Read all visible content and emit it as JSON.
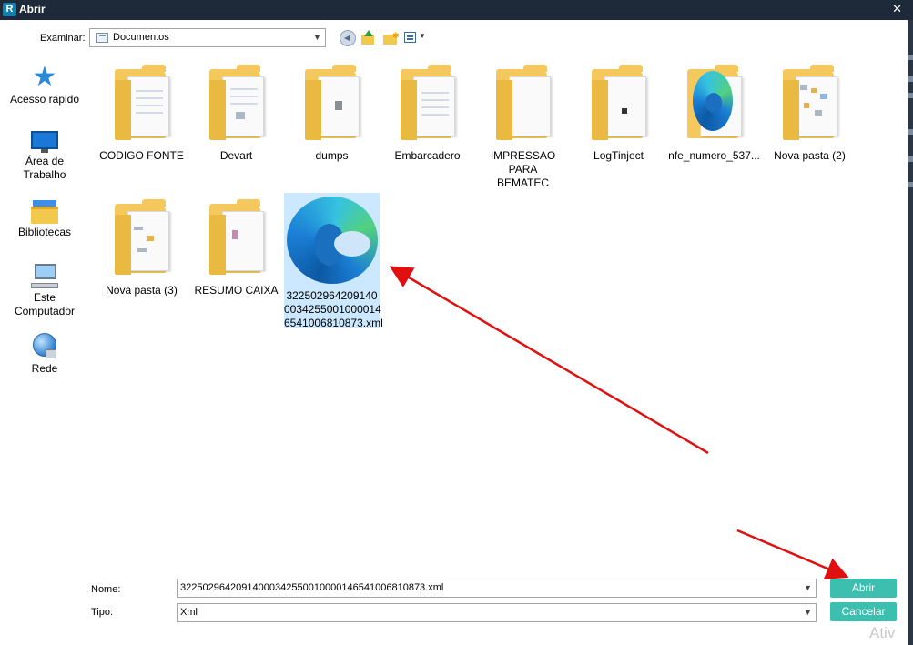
{
  "window": {
    "title": "Abrir",
    "app_icon_letter": "R"
  },
  "toolbar": {
    "lookin_label": "Examinar:",
    "lookin_value": "Documentos"
  },
  "places": [
    {
      "label": "Acesso rápido",
      "icon": "star-icon"
    },
    {
      "label_line1": "Área de",
      "label_line2": "Trabalho",
      "icon": "desktop-icon"
    },
    {
      "label": "Bibliotecas",
      "icon": "libraries-icon"
    },
    {
      "label_line1": "Este",
      "label_line2": "Computador",
      "icon": "computer-icon"
    },
    {
      "label": "Rede",
      "icon": "network-icon"
    }
  ],
  "files": [
    {
      "name": "CODIGO FONTE",
      "type": "folder"
    },
    {
      "name": "Devart",
      "type": "folder"
    },
    {
      "name": "dumps",
      "type": "folder"
    },
    {
      "name": "Embarcadero",
      "type": "folder"
    },
    {
      "name_line1": "IMPRESSAO PARA",
      "name_line2": "BEMATEC",
      "type": "folder"
    },
    {
      "name": "LogTinject",
      "type": "folder"
    },
    {
      "name": "nfe_numero_537...",
      "type": "folder"
    },
    {
      "name": "Nova pasta (2)",
      "type": "folder"
    },
    {
      "name": "Nova pasta (3)",
      "type": "folder"
    },
    {
      "name": "RESUMO CAIXA",
      "type": "folder"
    },
    {
      "name_line1": "322502964209140",
      "name_line2": "0034255001000014",
      "name_line3": "6541006810873.xml",
      "type": "xml-file",
      "selected": true
    }
  ],
  "footer": {
    "name_label": "Nome:",
    "name_value": "32250296420914000342550010000146541006810873.xml",
    "type_label": "Tipo:",
    "type_value": "Xml",
    "open_button": "Abrir",
    "cancel_button": "Cancelar"
  },
  "watermark": "Ativ",
  "colors": {
    "accent_button": "#3cbfae",
    "selection": "#cce8ff",
    "annotation_arrow": "#e01010",
    "titlebar": "#1e2a39"
  }
}
